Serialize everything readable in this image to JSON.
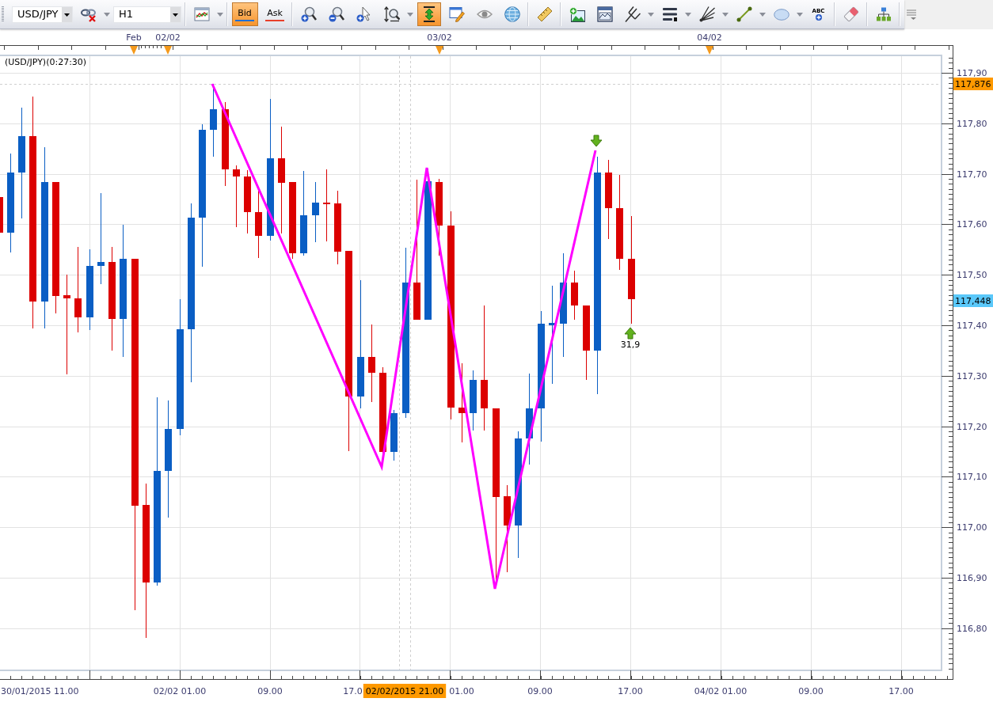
{
  "toolbar": {
    "groups": [
      [
        {
          "kind": "select",
          "value": "USD/JPY"
        },
        {
          "kind": "icon",
          "selected": false,
          "menu": true
        },
        {
          "kind": "select",
          "value": "H1"
        }
      ],
      [
        {
          "kind": "icon",
          "selected": false,
          "menu": true
        }
      ],
      [
        {
          "kind": "text",
          "label": "Bid",
          "selected": true,
          "color": "#1f6fd6"
        },
        {
          "kind": "text",
          "label": "Ask",
          "selected": false,
          "color": "#e8402a"
        }
      ],
      [
        {
          "kind": "icon",
          "selected": false,
          "menu": false
        },
        {
          "kind": "icon",
          "selected": false,
          "menu": false
        },
        {
          "kind": "icon",
          "selected": false,
          "menu": false
        },
        {
          "kind": "icon",
          "selected": false,
          "menu": true
        },
        {
          "kind": "icon",
          "selected": true,
          "menu": false
        },
        {
          "kind": "icon",
          "selected": false,
          "menu": false
        },
        {
          "kind": "icon",
          "selected": false,
          "menu": false
        },
        {
          "kind": "icon",
          "selected": false,
          "menu": false
        }
      ],
      [
        {
          "kind": "icon",
          "selected": false,
          "menu": false
        }
      ],
      [
        {
          "kind": "icon",
          "selected": false,
          "menu": false
        },
        {
          "kind": "icon",
          "selected": false,
          "menu": false
        },
        {
          "kind": "icon",
          "selected": false,
          "menu": true
        },
        {
          "kind": "icon",
          "selected": false,
          "menu": true
        },
        {
          "kind": "icon",
          "selected": false,
          "menu": true
        },
        {
          "kind": "icon",
          "selected": false,
          "menu": true
        },
        {
          "kind": "icon",
          "selected": false,
          "menu": true
        },
        {
          "kind": "label_icon",
          "label": "ABC",
          "selected": false,
          "menu": false
        }
      ],
      [
        {
          "kind": "icon",
          "selected": false,
          "menu": false
        }
      ],
      [
        {
          "kind": "icon",
          "selected": false,
          "menu": false
        }
      ],
      [
        {
          "kind": "overflow"
        }
      ]
    ]
  },
  "chart": {
    "title": "(USD/JPY)(0:27:30)",
    "date_marks": [
      {
        "label": "Feb"
      },
      {
        "label": "02/02"
      },
      {
        "label": "03/02"
      },
      {
        "label": "04/02"
      }
    ],
    "price_axis": [
      "117,90",
      "117,80",
      "117,70",
      "117,60",
      "117,50",
      "117,40",
      "117,30",
      "117,20",
      "117,10",
      "117,00",
      "116,90",
      "116,80"
    ],
    "price_tags": [
      {
        "label": "117,876",
        "color": "#ff9900"
      },
      {
        "label": "117,448",
        "color": "#5ac8fa"
      }
    ],
    "time_axis": [
      "30/01/2015 11.00",
      "02/02 01.00",
      "09.00",
      "17.0",
      "01.00",
      "09.00",
      "17.00",
      "04/02 01.00",
      "09.00",
      "17.00"
    ],
    "cursor_time": "02/02/2015 21.00",
    "swing_label": "31,9"
  }
}
